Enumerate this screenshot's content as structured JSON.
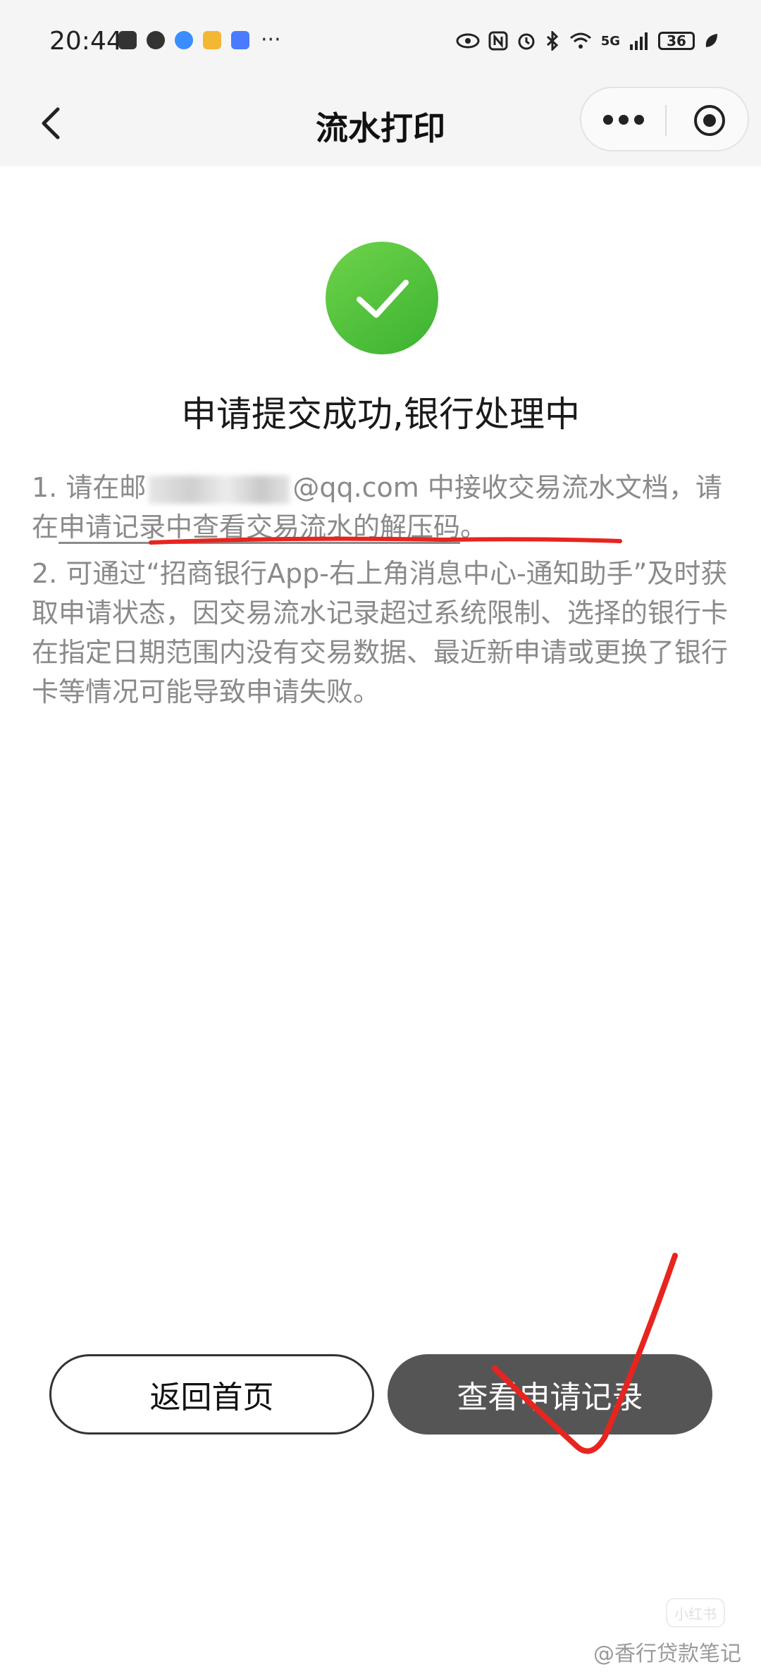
{
  "status_bar": {
    "time": "20:44",
    "more": "···",
    "signal_label": "5G",
    "battery": "36",
    "left_icon_colors": [
      "#333333",
      "#333333",
      "#3a8dff",
      "#f3b733",
      "#4a7bff"
    ]
  },
  "nav": {
    "title": "流水打印"
  },
  "result": {
    "title": "申请提交成功,银行处理中",
    "icon": "check-circle-icon",
    "icon_color": "#4cc23a"
  },
  "notes": {
    "note1_prefix": "1. 请在邮",
    "note1_email_suffix": "@qq.com 中接收交易流水文档，请在",
    "note1_highlight": "申请记录中查看交易流水的解压码",
    "note1_end": "。",
    "note2": "2. 可通过“招商银行App-右上角消息中心-通知助手”及时获取申请状态，因交易流水记录超过系统限制、选择的银行卡在指定日期范围内没有交易数据、最近新申请或更换了银行卡等情况可能导致申请失败。"
  },
  "buttons": {
    "home_label": "返回首页",
    "records_label": "查看申请记录"
  },
  "annotation_color": "#e8241f",
  "watermark": {
    "logo_text": "小红书",
    "text": "@香行贷款笔记"
  }
}
